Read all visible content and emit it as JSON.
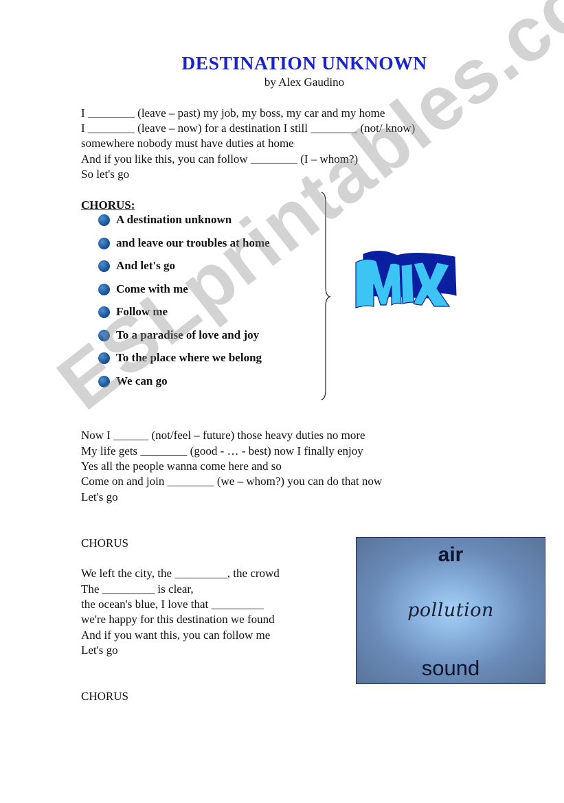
{
  "header": {
    "title": "DESTINATION UNKNOWN",
    "author": "by Alex Gaudino"
  },
  "verse1": [
    "I ________ (leave – past) my job, my boss, my car and my home",
    "I ________ (leave – now) for a destination I still ________ (not/ know)",
    "somewhere nobody must have duties at home",
    "And if you like this, you can follow ________ (I – whom?)",
    "So let's go"
  ],
  "chorus": {
    "heading": "CHORUS:",
    "lines": [
      "A destination unknown",
      "and leave our troubles at home",
      "And let's go",
      "Come with me",
      "Follow me",
      "To a paradise of love and joy",
      "To the place where we belong",
      "We can go"
    ]
  },
  "mix_art": {
    "text": "MIX",
    "face_color": "#3cc4f5",
    "shadow_color": "#0a1fa0"
  },
  "verse2": [
    "Now I ______ (not/feel – future) those heavy duties no more",
    "My life gets ________ (good - … - best) now I finally enjoy",
    "Yes all the people wanna come here and so",
    "Come on and join ________ (we – whom?) you can do that now",
    "Let's go"
  ],
  "chorus_marker_1": "CHORUS",
  "verse3": [
    "We left the city, the _________, the crowd",
    "The _________ is clear,",
    "the ocean's blue, I love that _________",
    "we're happy for this destination we found",
    "And if you want this, you can follow me",
    "Let's go"
  ],
  "chorus_marker_2": "CHORUS",
  "word_box": {
    "top": "air",
    "middle": "pollution",
    "bottom": "sound"
  },
  "watermark": "ESLprintables.com",
  "colors": {
    "title": "#1a24c8",
    "bullet": "#1c5a9e"
  }
}
